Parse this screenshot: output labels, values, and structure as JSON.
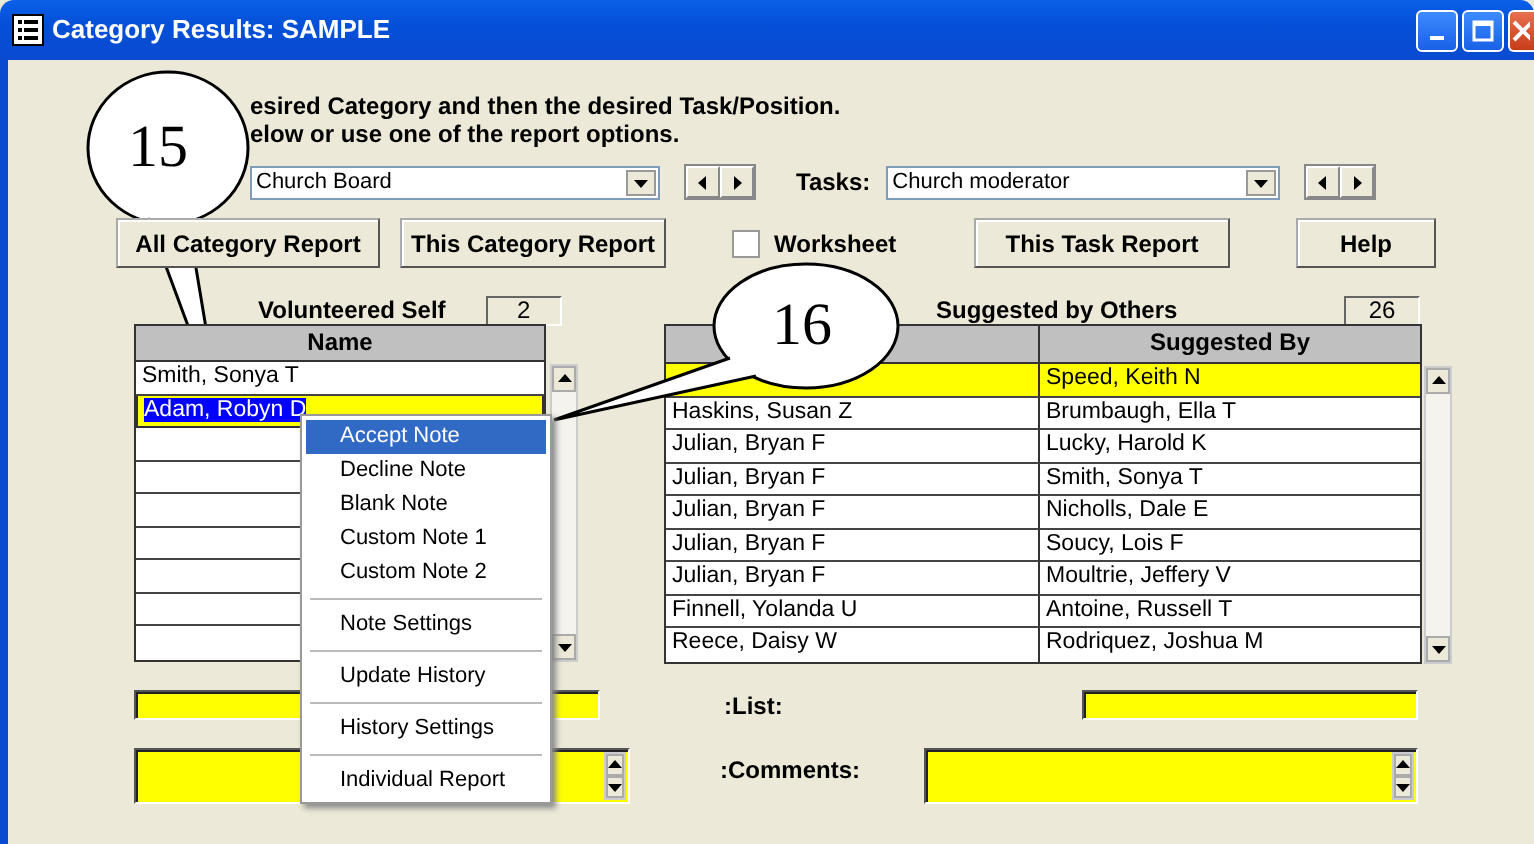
{
  "window": {
    "title": "Category Results: SAMPLE"
  },
  "instructions": [
    "esired Category and then the desired Task/Position.",
    "elow or use one of the report options."
  ],
  "category": {
    "value": "Church Board"
  },
  "tasks": {
    "label": "Tasks:",
    "value": "Church moderator"
  },
  "buttons": [
    "All Category Report",
    "This Category Report"
  ],
  "worksheet": {
    "label": "Worksheet",
    "checked": false
  },
  "buttons_right": [
    "This Task Report",
    "Help"
  ],
  "volunteered": {
    "label": "Volunteered Self",
    "count": "2",
    "columns": [
      "Name"
    ],
    "rows": [
      {
        "name": "Smith, Sonya T",
        "selected": false
      },
      {
        "name": "Adam, Robyn D",
        "selected": true
      }
    ]
  },
  "suggested": {
    "label": "Suggested by Others",
    "count": "26",
    "columns": [
      "Suggested By"
    ],
    "rows": [
      {
        "suggested_by": "Speed, Keith N",
        "selected": true
      },
      {
        "name": "Haskins, Susan Z",
        "suggested_by": "Brumbaugh, Ella T",
        "selected": false
      },
      {
        "name": "Julian, Bryan F",
        "suggested_by": "Lucky, Harold K",
        "selected": false
      },
      {
        "name": "Julian, Bryan F",
        "suggested_by": "Smith, Sonya T",
        "selected": false
      },
      {
        "name": "Julian, Bryan F",
        "suggested_by": "Nicholls, Dale E",
        "selected": false
      },
      {
        "name": "Julian, Bryan F",
        "suggested_by": "Soucy, Lois F",
        "selected": false
      },
      {
        "name": "Julian, Bryan F",
        "suggested_by": "Moultrie, Jeffery V",
        "selected": false
      },
      {
        "name": "Finnell, Yolanda U",
        "suggested_by": "Antoine, Russell T",
        "selected": false
      },
      {
        "name": "Reece, Daisy W",
        "suggested_by": "Rodriquez, Joshua M",
        "selected": false
      }
    ]
  },
  "list": {
    "label": ":List:"
  },
  "comments": {
    "label": ":Comments:"
  },
  "context_menu": {
    "groups": [
      [
        {
          "label": "Accept Note",
          "selected": true
        },
        {
          "label": "Decline Note",
          "selected": false
        },
        {
          "label": "Blank Note",
          "selected": false
        },
        {
          "label": "Custom Note 1",
          "selected": false
        },
        {
          "label": "Custom Note 2",
          "selected": false
        }
      ],
      [
        {
          "label": "Note Settings",
          "selected": false
        }
      ],
      [
        {
          "label": "Update History",
          "selected": false
        }
      ],
      [
        {
          "label": "History Settings",
          "selected": false
        }
      ],
      [
        {
          "label": "Individual Report",
          "selected": false
        }
      ]
    ]
  },
  "callouts": [
    {
      "number": "15"
    },
    {
      "number": "16"
    }
  ]
}
